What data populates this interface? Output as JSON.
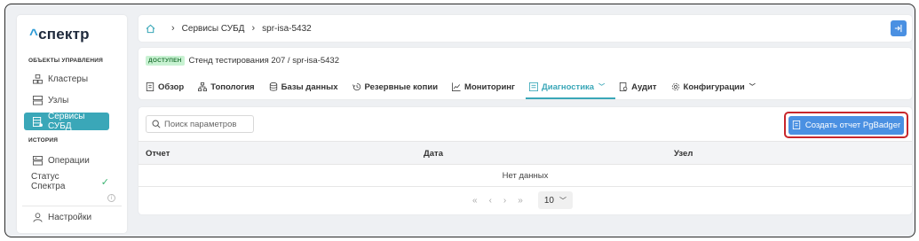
{
  "sidebar": {
    "logo": "спектр",
    "section_objects": "ОБЪЕКТЫ УПРАВЛЕНИЯ",
    "items": [
      {
        "label": "Кластеры"
      },
      {
        "label": "Узлы"
      },
      {
        "label": "Сервисы СУБД"
      }
    ],
    "section_history": "ИСТОРИЯ",
    "history_items": [
      {
        "label": "Операции"
      },
      {
        "label": "Статус Спектра"
      }
    ],
    "settings_label": "Настройки"
  },
  "breadcrumb": {
    "items": [
      "Сервисы СУБД",
      "spr-isa-5432"
    ]
  },
  "header": {
    "badge": "ДОСТУПЕН",
    "title": "Стенд тестирования 207 /  spr-isa-5432",
    "tabs": [
      {
        "label": "Обзор"
      },
      {
        "label": "Топология"
      },
      {
        "label": "Базы данных"
      },
      {
        "label": "Резервные копии"
      },
      {
        "label": "Мониторинг"
      },
      {
        "label": "Диагностика"
      },
      {
        "label": "Аудит"
      },
      {
        "label": "Конфигурации"
      }
    ]
  },
  "main": {
    "search_placeholder": "Поиск параметров",
    "create_button": "Создать отчет PgBadger",
    "columns": [
      "Отчет",
      "Дата",
      "Узел"
    ],
    "empty_text": "Нет данных",
    "pager": {
      "first": "«",
      "prev": "‹",
      "next": "›",
      "last": "»",
      "page_size": "10"
    }
  },
  "colors": {
    "accent": "#3aa7b8",
    "primary_button": "#4a90e2",
    "highlight_border": "#c8262b",
    "badge_bg": "#c8f2d2"
  }
}
